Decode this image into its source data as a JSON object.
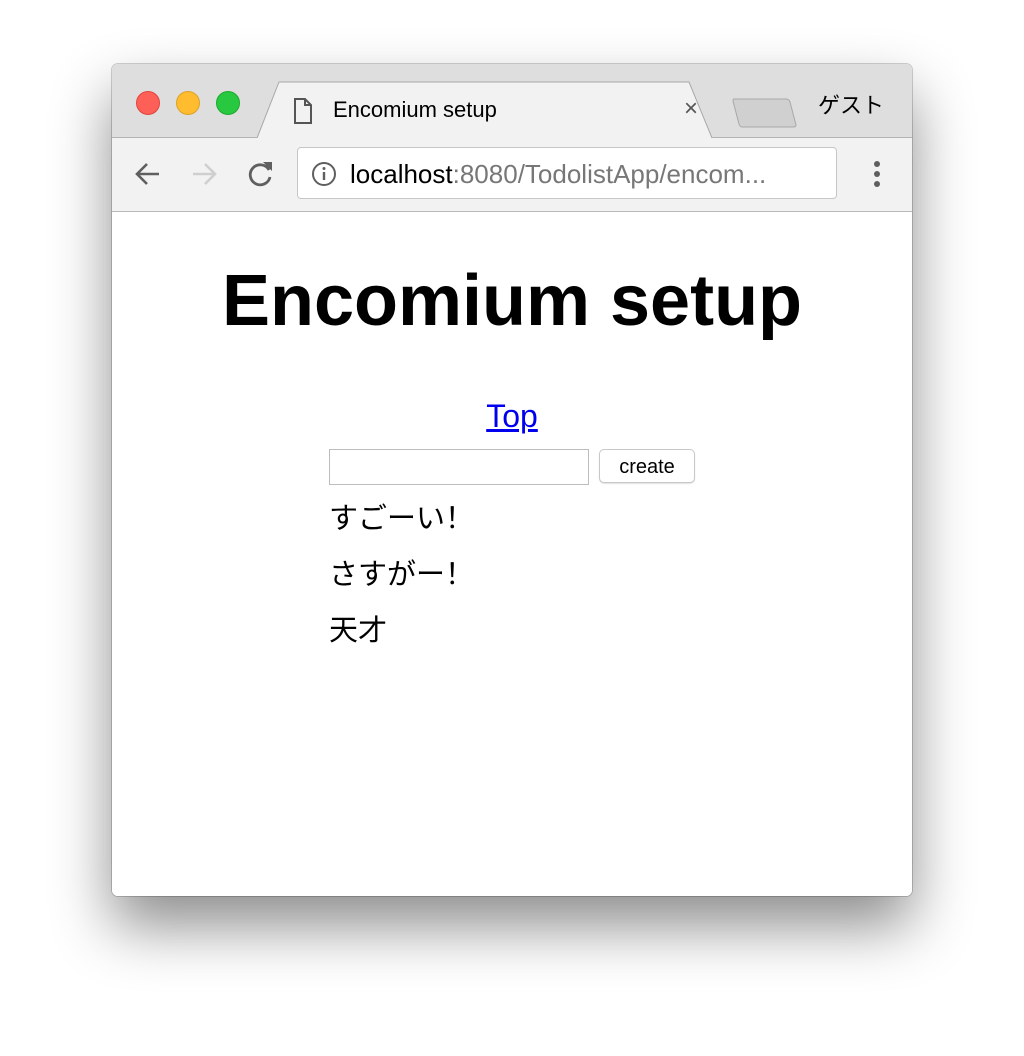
{
  "browser": {
    "tab_title": "Encomium setup",
    "tab_close": "×",
    "profile_label": "ゲスト",
    "url_host": "localhost",
    "url_rest": ":8080/TodolistApp/encom...",
    "traffic_light_colors": {
      "close": "#fe5f57",
      "minimize": "#febc2e",
      "zoom": "#28c840"
    }
  },
  "page": {
    "heading": "Encomium setup",
    "top_link": "Top",
    "input_value": "",
    "create_label": "create",
    "items": [
      "すごーい！",
      "さすがー！",
      "天才"
    ]
  }
}
